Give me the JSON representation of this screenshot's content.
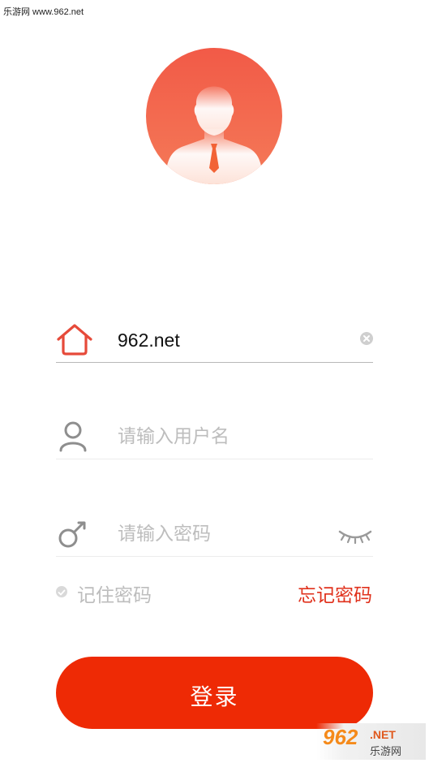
{
  "watermark": {
    "text": "乐游网 www.962.net"
  },
  "avatar": {
    "icon": "user-avatar-icon",
    "colors": [
      "#f25a47",
      "#f47a58"
    ]
  },
  "server_field": {
    "icon": "home-icon",
    "value": "962.net",
    "clear_icon": "clear-icon"
  },
  "username_field": {
    "icon": "user-icon",
    "placeholder": "请输入用户名"
  },
  "password_field": {
    "icon": "key-icon",
    "placeholder": "请输入密码",
    "toggle_icon": "eye-closed-icon"
  },
  "remember": {
    "label": "记住密码",
    "checked": false
  },
  "forgot_label": "忘记密码",
  "login_label": "登录",
  "corner_logo": {
    "brand": "962",
    "suffix": ".NET",
    "cn": "乐游网"
  },
  "colors": {
    "accent": "#ee2a05",
    "link": "#e0311c",
    "placeholder": "#bdbdbd"
  }
}
